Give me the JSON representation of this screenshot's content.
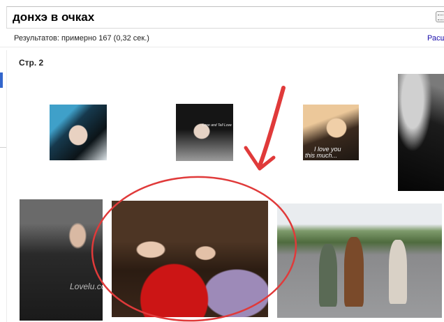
{
  "search": {
    "query": "донхэ в очках"
  },
  "results": {
    "stats": "Результатов: примерно 167 (0,32 сек.)",
    "advanced_link": "Расш"
  },
  "page": {
    "label": "Стр. 2"
  },
  "thumbnails": [
    {
      "caption": ""
    },
    {
      "caption": "Love and Tell Love"
    },
    {
      "caption_line1": "I love you",
      "caption_line2": "this much..."
    },
    {
      "caption": ""
    },
    {
      "caption": "Lovelu.com"
    },
    {
      "caption": ""
    },
    {
      "caption": ""
    }
  ],
  "annotations": {
    "arrow_color": "#e03a3a",
    "circle_color": "#e03a3a"
  },
  "colors": {
    "link": "#1a0dab",
    "accent": "#3366cc"
  }
}
